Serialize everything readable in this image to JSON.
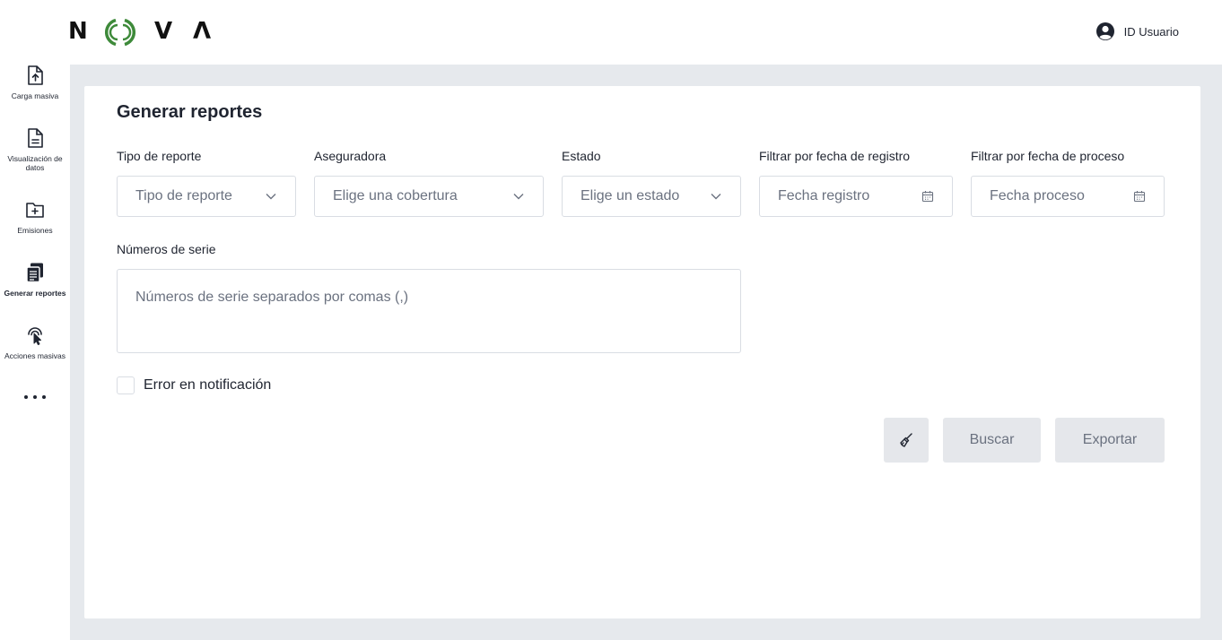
{
  "brand": {
    "letters": [
      "N",
      "V",
      "Λ"
    ]
  },
  "user": {
    "label": "ID Usuario"
  },
  "sidebar": {
    "items": [
      {
        "label": "Carga masiva",
        "icon": "file-upload-icon"
      },
      {
        "label": "Visualización de datos",
        "icon": "file-text-icon"
      },
      {
        "label": "Emisiones",
        "icon": "folder-plus-icon"
      },
      {
        "label": "Generar reportes",
        "icon": "reports-icon",
        "active": true
      },
      {
        "label": "Acciones masivas",
        "icon": "touch-tap-icon"
      }
    ],
    "more": "more-icon"
  },
  "page": {
    "title": "Generar reportes"
  },
  "filters": {
    "tipo": {
      "label": "Tipo de reporte",
      "placeholder": "Tipo de reporte"
    },
    "aseguradora": {
      "label": "Aseguradora",
      "placeholder": "Elige una cobertura"
    },
    "estado": {
      "label": "Estado",
      "placeholder": "Elige un estado"
    },
    "fecha_registro": {
      "label": "Filtrar por fecha de registro",
      "placeholder": "Fecha registro"
    },
    "fecha_proceso": {
      "label": "Filtrar por fecha de proceso",
      "placeholder": "Fecha proceso"
    }
  },
  "serials": {
    "label": "Números de serie",
    "placeholder": "Números de serie separados por comas (,)"
  },
  "error_check": {
    "label": "Error en notificación",
    "checked": false
  },
  "actions": {
    "search": "Buscar",
    "export": "Exportar"
  },
  "colors": {
    "brand_green": "#3e8a3a",
    "background": "#e6e9ed",
    "button_bg": "#e5e7eb"
  }
}
